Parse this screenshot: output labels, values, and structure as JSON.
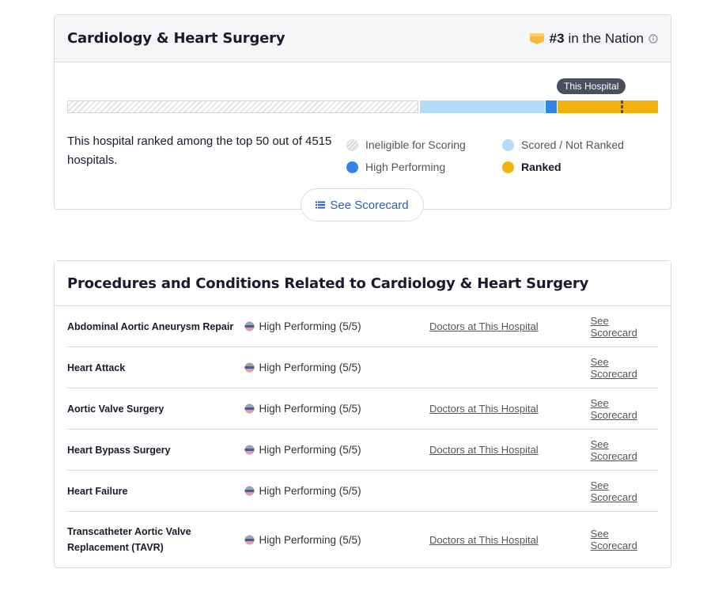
{
  "specialty": {
    "title": "Cardiology & Heart Surgery",
    "rank_number": "#3",
    "rank_suffix": "in the Nation",
    "ribbon_icon": "ribbon-icon",
    "info_icon": "info-icon",
    "tooltip": "This Hospital",
    "summary": "This hospital ranked among the top 50 out of 4515 hospitals.",
    "legend": [
      {
        "label": "Ineligible for Scoring",
        "color": "#e4e4e4"
      },
      {
        "label": "High Performing",
        "color": "#2f86e4"
      },
      {
        "label": "Scored / Not Ranked",
        "color": "#b3dcfa"
      },
      {
        "label": "Ranked",
        "color": "#f2b10c"
      }
    ],
    "scorecard_button": "See Scorecard",
    "scorecard_icon": "list-icon"
  },
  "procedures": {
    "title": "Procedures and Conditions Related to Cardiology & Heart Surgery",
    "rows": [
      {
        "name": "Abdominal Aortic Aneurysm Repair",
        "rating": "High Performing (5/5)",
        "doctors": "Doctors at This Hospital",
        "scorecard": "See Scorecard"
      },
      {
        "name": "Heart Attack",
        "rating": "High Performing (5/5)",
        "doctors": "",
        "scorecard": "See Scorecard"
      },
      {
        "name": "Aortic Valve Surgery",
        "rating": "High Performing (5/5)",
        "doctors": "Doctors at This Hospital",
        "scorecard": "See Scorecard"
      },
      {
        "name": "Heart Bypass Surgery",
        "rating": "High Performing (5/5)",
        "doctors": "Doctors at This Hospital",
        "scorecard": "See Scorecard"
      },
      {
        "name": "Heart Failure",
        "rating": "High Performing (5/5)",
        "doctors": "",
        "scorecard": "See Scorecard"
      },
      {
        "name": "Transcatheter Aortic Valve Replacement (TAVR)",
        "rating": "High Performing (5/5)",
        "doctors": "Doctors at This Hospital",
        "scorecard": "See Scorecard"
      }
    ]
  },
  "colors": {
    "ranked": "#f2b10c",
    "high_performing": "#2f86e4",
    "scored_not_ranked": "#b3dcfa",
    "link": "#2a5fc6",
    "tooltip_bg": "#4a4f5c"
  }
}
